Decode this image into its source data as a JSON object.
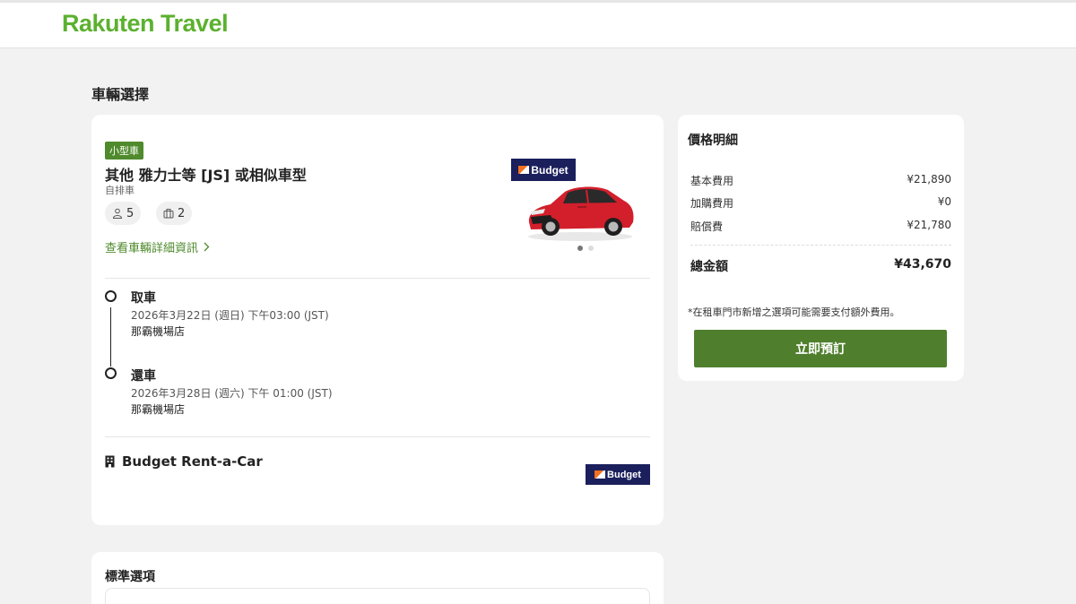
{
  "header": {
    "logo": "Rakuten Travel"
  },
  "page": {
    "title": "車輛選擇"
  },
  "car": {
    "category_badge": "小型車",
    "name": "其他 雅力士等 [JS] 或相似車型",
    "transmission": "自排車",
    "seats": "5",
    "luggage": "2",
    "details_link": "查看車輛詳細資訊",
    "brand_logo": "Budget",
    "car_color": "#d21f2b",
    "image_dots": 2,
    "active_dot": 1
  },
  "pickup": {
    "title": "取車",
    "datetime": "2026年3月22日 (週日) 下午03:00 (JST)",
    "location": "那霸機場店"
  },
  "dropoff": {
    "title": "還車",
    "datetime": "2026年3月28日 (週六) 下午 01:00 (JST)",
    "location": "那霸機場店"
  },
  "vendor": {
    "name": "Budget Rent-a-Car",
    "logo": "Budget"
  },
  "price": {
    "title": "價格明細",
    "rows": [
      {
        "label": "基本費用",
        "value": "¥21,890"
      },
      {
        "label": "加購費用",
        "value": "¥0"
      },
      {
        "label": "賠償費",
        "value": "¥21,780"
      }
    ],
    "total_label": "總金額",
    "total_value": "¥43,670",
    "note": "*在租車門市新增之選項可能需要支付額外費用。",
    "book_button": "立即預訂"
  },
  "options": {
    "title": "標準選項"
  },
  "colors": {
    "brand_green": "#5cb12f",
    "button_green": "#4f7f2d",
    "badge_green": "#4f8a2c",
    "budget_navy": "#1b1f5c",
    "budget_orange": "#f37021"
  }
}
